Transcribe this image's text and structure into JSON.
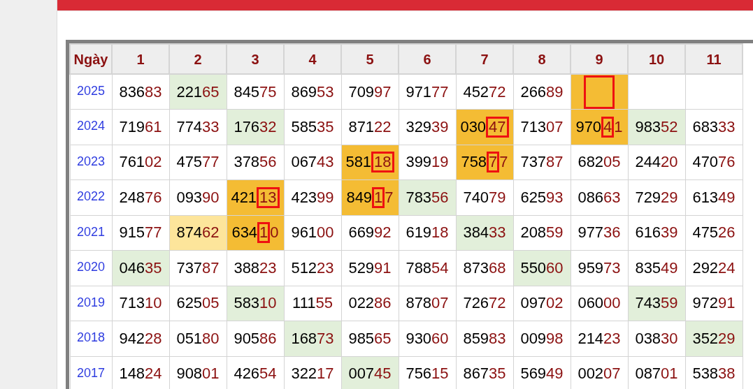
{
  "table": {
    "columns": [
      "Ngày",
      "1",
      "2",
      "3",
      "4",
      "5",
      "6",
      "7",
      "8",
      "9",
      "10",
      "11"
    ],
    "rows": [
      {
        "cells": [
          {
            "kind": "year",
            "value": "2025"
          },
          {
            "kind": "plain",
            "value": "83683"
          },
          {
            "kind": "plain",
            "value": "22165",
            "color": "#e2efda"
          },
          {
            "kind": "plain",
            "value": "84575"
          },
          {
            "kind": "plain",
            "value": "86953"
          },
          {
            "kind": "plain",
            "value": "70997"
          },
          {
            "kind": "plain",
            "value": "97177"
          },
          {
            "kind": "plain",
            "value": "45272"
          },
          {
            "kind": "plain",
            "value": "26689"
          },
          {
            "kind": "pair",
            "color": "#f4bc34"
          },
          {
            "kind": "plain"
          },
          {
            "kind": "plain"
          }
        ]
      },
      {
        "cells": [
          {
            "kind": "year",
            "value": "2024"
          },
          {
            "kind": "plain",
            "value": "71961"
          },
          {
            "kind": "plain",
            "value": "77433"
          },
          {
            "kind": "plain",
            "value": "17632",
            "color": "#e2efda"
          },
          {
            "kind": "plain",
            "value": "58535"
          },
          {
            "kind": "plain",
            "value": "87122"
          },
          {
            "kind": "plain",
            "value": "32939"
          },
          {
            "kind": "pair",
            "value": "03047",
            "color": "#f4bc34"
          },
          {
            "kind": "plain",
            "value": "71307"
          },
          {
            "kind": "tens",
            "value": "97041",
            "color": "#f4bc34"
          },
          {
            "kind": "plain",
            "value": "98352",
            "color": "#e2efda"
          },
          {
            "kind": "plain",
            "value": "68333"
          }
        ]
      },
      {
        "cells": [
          {
            "kind": "year",
            "value": "2023"
          },
          {
            "kind": "plain",
            "value": "76102"
          },
          {
            "kind": "plain",
            "value": "47577"
          },
          {
            "kind": "plain",
            "value": "37856"
          },
          {
            "kind": "plain",
            "value": "06743"
          },
          {
            "kind": "pair",
            "value": "58118",
            "color": "#f4bc34"
          },
          {
            "kind": "plain",
            "value": "39919"
          },
          {
            "kind": "tens",
            "value": "75877",
            "color": "#f4bc34"
          },
          {
            "kind": "plain",
            "value": "73787"
          },
          {
            "kind": "plain",
            "value": "68205"
          },
          {
            "kind": "plain",
            "value": "24420"
          },
          {
            "kind": "plain",
            "value": "47076"
          }
        ]
      },
      {
        "cells": [
          {
            "kind": "year",
            "value": "2022"
          },
          {
            "kind": "plain",
            "value": "24876"
          },
          {
            "kind": "plain",
            "value": "09390"
          },
          {
            "kind": "pair",
            "value": "42113",
            "color": "#f4bc34"
          },
          {
            "kind": "plain",
            "value": "42399"
          },
          {
            "kind": "tens",
            "value": "84917",
            "color": "#f4bc34"
          },
          {
            "kind": "plain",
            "value": "78356",
            "color": "#e2efda"
          },
          {
            "kind": "plain",
            "value": "74079"
          },
          {
            "kind": "plain",
            "value": "62593"
          },
          {
            "kind": "plain",
            "value": "08663"
          },
          {
            "kind": "plain",
            "value": "72929"
          },
          {
            "kind": "plain",
            "value": "61349"
          }
        ]
      },
      {
        "cells": [
          {
            "kind": "year",
            "value": "2021"
          },
          {
            "kind": "plain",
            "value": "91577"
          },
          {
            "kind": "plain",
            "value": "87462",
            "color": "#fde59b"
          },
          {
            "kind": "tens",
            "value": "63410",
            "color": "#f4bc34"
          },
          {
            "kind": "plain",
            "value": "96100"
          },
          {
            "kind": "plain",
            "value": "66992"
          },
          {
            "kind": "plain",
            "value": "61918"
          },
          {
            "kind": "plain",
            "value": "38433",
            "color": "#e2efda"
          },
          {
            "kind": "plain",
            "value": "20859"
          },
          {
            "kind": "plain",
            "value": "97736"
          },
          {
            "kind": "plain",
            "value": "61639"
          },
          {
            "kind": "plain",
            "value": "47526"
          }
        ]
      },
      {
        "cells": [
          {
            "kind": "year",
            "value": "2020"
          },
          {
            "kind": "plain",
            "value": "04635",
            "color": "#e2efda"
          },
          {
            "kind": "plain",
            "value": "73787"
          },
          {
            "kind": "plain",
            "value": "38823"
          },
          {
            "kind": "plain",
            "value": "51223"
          },
          {
            "kind": "plain",
            "value": "52991"
          },
          {
            "kind": "plain",
            "value": "78854"
          },
          {
            "kind": "plain",
            "value": "87368"
          },
          {
            "kind": "plain",
            "value": "55060",
            "color": "#e2efda"
          },
          {
            "kind": "plain",
            "value": "95973"
          },
          {
            "kind": "plain",
            "value": "83549"
          },
          {
            "kind": "plain",
            "value": "29224"
          }
        ]
      },
      {
        "cells": [
          {
            "kind": "year",
            "value": "2019"
          },
          {
            "kind": "plain",
            "value": "71310"
          },
          {
            "kind": "plain",
            "value": "62505"
          },
          {
            "kind": "plain",
            "value": "58310",
            "color": "#e2efda"
          },
          {
            "kind": "plain",
            "value": "11155"
          },
          {
            "kind": "plain",
            "value": "02286"
          },
          {
            "kind": "plain",
            "value": "87807"
          },
          {
            "kind": "plain",
            "value": "72672"
          },
          {
            "kind": "plain",
            "value": "09702"
          },
          {
            "kind": "plain",
            "value": "06000"
          },
          {
            "kind": "plain",
            "value": "74359",
            "color": "#e2efda"
          },
          {
            "kind": "plain",
            "value": "97291"
          }
        ]
      },
      {
        "cells": [
          {
            "kind": "year",
            "value": "2018"
          },
          {
            "kind": "plain",
            "value": "94228"
          },
          {
            "kind": "plain",
            "value": "05180"
          },
          {
            "kind": "plain",
            "value": "90586"
          },
          {
            "kind": "plain",
            "value": "16873",
            "color": "#e2efda"
          },
          {
            "kind": "plain",
            "value": "98565"
          },
          {
            "kind": "plain",
            "value": "93060"
          },
          {
            "kind": "plain",
            "value": "85983"
          },
          {
            "kind": "plain",
            "value": "00998"
          },
          {
            "kind": "plain",
            "value": "21423"
          },
          {
            "kind": "plain",
            "value": "03830"
          },
          {
            "kind": "plain",
            "value": "35229",
            "color": "#e2efda"
          }
        ]
      },
      {
        "cells": [
          {
            "kind": "year",
            "value": "2017"
          },
          {
            "kind": "plain",
            "value": "14824"
          },
          {
            "kind": "plain",
            "value": "90801"
          },
          {
            "kind": "plain",
            "value": "42654"
          },
          {
            "kind": "plain",
            "value": "32217"
          },
          {
            "kind": "plain",
            "value": "00745",
            "color": "#e2efda"
          },
          {
            "kind": "plain",
            "value": "75615"
          },
          {
            "kind": "plain",
            "value": "86735"
          },
          {
            "kind": "plain",
            "value": "56949"
          },
          {
            "kind": "plain",
            "value": "00207"
          },
          {
            "kind": "plain",
            "value": "08701"
          },
          {
            "kind": "plain",
            "value": "53838"
          }
        ]
      }
    ]
  }
}
